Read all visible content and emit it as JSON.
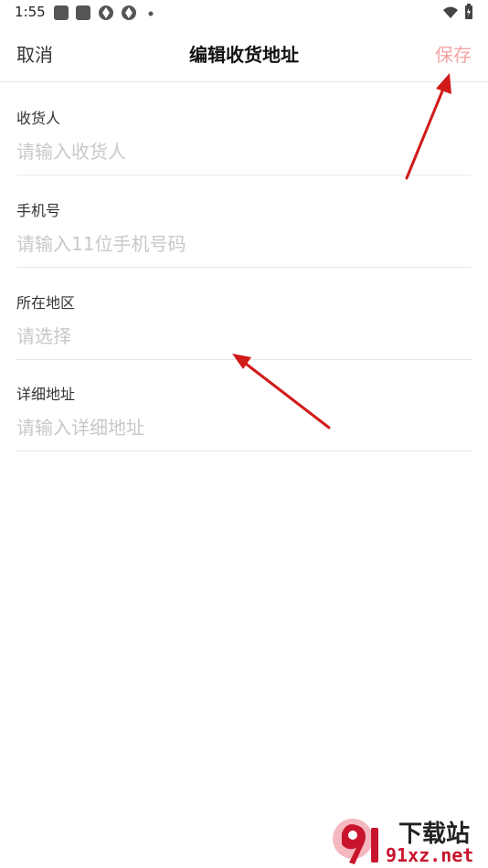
{
  "status_bar": {
    "time": "1:55",
    "icons": [
      "square-icon",
      "square-icon",
      "aperture-icon",
      "aperture-icon",
      "dot-icon",
      "wifi-icon",
      "battery-icon"
    ]
  },
  "header": {
    "cancel_label": "取消",
    "title": "编辑收货地址",
    "save_label": "保存"
  },
  "form": {
    "fields": [
      {
        "label": "收货人",
        "placeholder": "请输入收货人",
        "value": ""
      },
      {
        "label": "手机号",
        "placeholder": "请输入11位手机号码",
        "value": ""
      },
      {
        "label": "所在地区",
        "placeholder": "请选择",
        "value": ""
      },
      {
        "label": "详细地址",
        "placeholder": "请输入详细地址",
        "value": ""
      }
    ]
  },
  "colors": {
    "save_disabled": "#f3a3a3",
    "annotation_arrow": "#d11a1a",
    "placeholder": "#c8c8c8"
  },
  "watermark": {
    "top_text": "下载站",
    "bottom_text": "91xz.net"
  }
}
